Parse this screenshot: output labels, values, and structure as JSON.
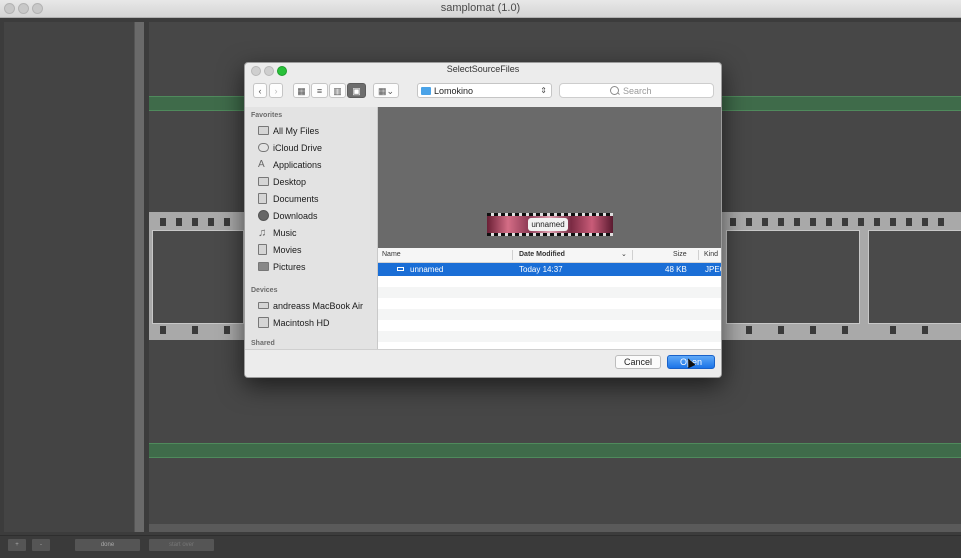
{
  "app": {
    "title": "samplomat (1.0)"
  },
  "bottombar": {
    "add_label": "+",
    "remove_label": "-",
    "done_label": "done",
    "start_label": "start over"
  },
  "dialog": {
    "title": "SelectSourceFiles",
    "location": "Lomokino",
    "search_placeholder": "Search",
    "cancel_label": "Cancel",
    "open_label": "Open"
  },
  "icons": {
    "back": "chevron-left-icon",
    "forward": "chevron-right-icon",
    "folder": "folder-icon",
    "search": "search-icon"
  },
  "colors": {
    "accent": "#1a6ed6",
    "green_band": "#3f6b4a"
  },
  "sidebar": {
    "favorites_header": "Favorites",
    "favorites": [
      {
        "label": "All My Files",
        "icon": "all-files-icon"
      },
      {
        "label": "iCloud Drive",
        "icon": "cloud-icon"
      },
      {
        "label": "Applications",
        "icon": "applications-icon"
      },
      {
        "label": "Desktop",
        "icon": "desktop-icon"
      },
      {
        "label": "Documents",
        "icon": "documents-icon"
      },
      {
        "label": "Downloads",
        "icon": "downloads-icon"
      },
      {
        "label": "Music",
        "icon": "music-icon"
      },
      {
        "label": "Movies",
        "icon": "movies-icon"
      },
      {
        "label": "Pictures",
        "icon": "pictures-icon"
      }
    ],
    "devices_header": "Devices",
    "devices": [
      {
        "label": "andreass MacBook Air",
        "icon": "laptop-icon"
      },
      {
        "label": "Macintosh HD",
        "icon": "disk-icon"
      }
    ],
    "shared_header": "Shared"
  },
  "preview": {
    "thumb_label": "unnamed"
  },
  "table": {
    "headers": [
      "Name",
      "Date Modified",
      "Size",
      "Kind"
    ],
    "rows": [
      {
        "name": "unnamed",
        "date": "Today 14:37",
        "size": "48 KB",
        "kind": "JPEG"
      }
    ]
  }
}
